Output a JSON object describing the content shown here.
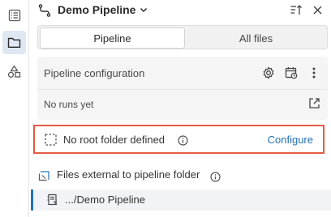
{
  "header": {
    "title": "Demo Pipeline",
    "title_icon": "pipeline-icon",
    "chevron_icon": "chevron-down-icon",
    "sort_icon": "sort-icon",
    "close_icon": "close-icon"
  },
  "rail": {
    "items": [
      {
        "icon": "list-icon",
        "active": false
      },
      {
        "icon": "folder-icon",
        "active": true
      },
      {
        "icon": "shapes-icon",
        "active": false
      }
    ]
  },
  "tabs": [
    {
      "label": "Pipeline",
      "active": true
    },
    {
      "label": "All files",
      "active": false
    }
  ],
  "config": {
    "title": "Pipeline configuration",
    "status": "No runs yet",
    "icons": [
      "gear-icon",
      "calendar-icon",
      "more-vert-icon",
      "external-link-icon"
    ]
  },
  "root": {
    "text": "No root folder defined",
    "action": "Configure",
    "accent": "#e35a45"
  },
  "external": {
    "label": "Files external to pipeline folder"
  },
  "file": {
    "label": ".../Demo Pipeline"
  },
  "colors": {
    "link": "#2272b4",
    "highlight_border": "#e35a45",
    "selected_bg": "#dfe7f3"
  }
}
